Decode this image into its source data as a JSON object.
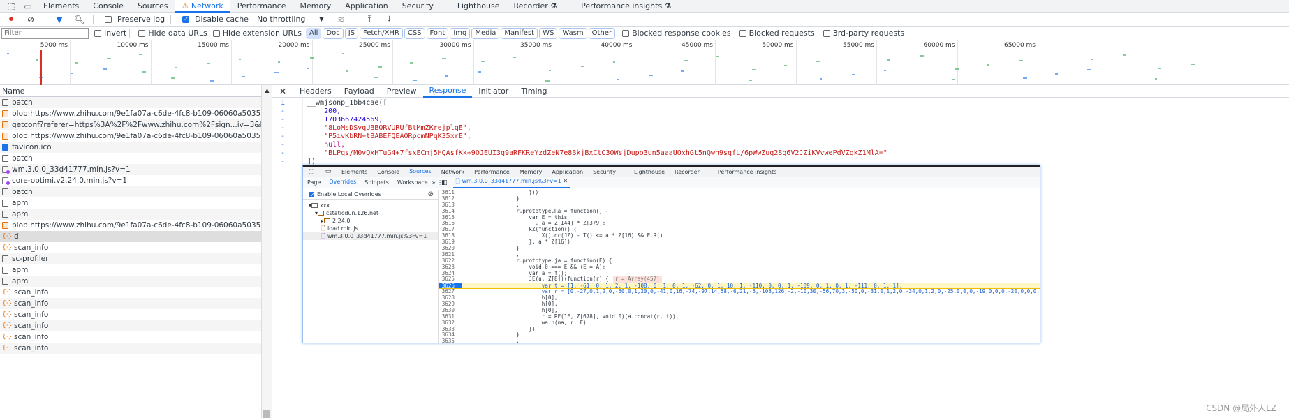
{
  "devtools_tabs": [
    "Elements",
    "Console",
    "Sources",
    "Network",
    "Performance",
    "Memory",
    "Application",
    "Security",
    "Lighthouse",
    "Recorder",
    "Performance insights"
  ],
  "active_tab": "Network",
  "toolbar": {
    "preserve_log": "Preserve log",
    "disable_cache": "Disable cache",
    "throttling": "No throttling"
  },
  "filter": {
    "placeholder": "Filter",
    "invert": "Invert",
    "hide_data": "Hide data URLs",
    "hide_ext": "Hide extension URLs",
    "types": [
      "All",
      "Doc",
      "JS",
      "Fetch/XHR",
      "CSS",
      "Font",
      "Img",
      "Media",
      "Manifest",
      "WS",
      "Wasm",
      "Other"
    ],
    "blocked_cookies": "Blocked response cookies",
    "blocked_requests": "Blocked requests",
    "third_party": "3rd-party requests"
  },
  "overview_ticks": [
    "5000 ms",
    "10000 ms",
    "15000 ms",
    "20000 ms",
    "25000 ms",
    "30000 ms",
    "35000 ms",
    "40000 ms",
    "45000 ms",
    "50000 ms",
    "55000 ms",
    "60000 ms",
    "65000 ms"
  ],
  "requests": {
    "header": "Name",
    "rows": [
      {
        "name": "batch",
        "type": "doc"
      },
      {
        "name": "blob:https://www.zhihu.com/9e1fa07a-c6de-4fc8-b109-06060a5035a0",
        "type": "xhr"
      },
      {
        "name": "getconf?referer=https%3A%2F%2Fwww.zhihu.com%2Fsign...iv=3&loadVersion=2.4.0&...",
        "type": "xhr"
      },
      {
        "name": "blob:https://www.zhihu.com/9e1fa07a-c6de-4fc8-b109-06060a5035a0",
        "type": "xhr"
      },
      {
        "name": "favicon.ico",
        "type": "fav"
      },
      {
        "name": "batch",
        "type": "doc"
      },
      {
        "name": "wm.3.0.0_33d41777.min.js?v=1",
        "type": "js"
      },
      {
        "name": "core-optimi.v2.24.0.min.js?v=1",
        "type": "js"
      },
      {
        "name": "batch",
        "type": "doc"
      },
      {
        "name": "apm",
        "type": "doc"
      },
      {
        "name": "apm",
        "type": "doc"
      },
      {
        "name": "blob:https://www.zhihu.com/9e1fa07a-c6de-4fc8-b109-06060a5035a0",
        "type": "xhr"
      },
      {
        "name": "d",
        "type": "json",
        "selected": true
      },
      {
        "name": "scan_info",
        "type": "json"
      },
      {
        "name": "sc-profiler",
        "type": "doc"
      },
      {
        "name": "apm",
        "type": "doc"
      },
      {
        "name": "apm",
        "type": "doc"
      },
      {
        "name": "scan_info",
        "type": "json"
      },
      {
        "name": "scan_info",
        "type": "json"
      },
      {
        "name": "scan_info",
        "type": "json"
      },
      {
        "name": "scan_info",
        "type": "json"
      },
      {
        "name": "scan_info",
        "type": "json"
      },
      {
        "name": "scan_info",
        "type": "json"
      }
    ]
  },
  "detail_tabs": [
    "Headers",
    "Payload",
    "Preview",
    "Response",
    "Initiator",
    "Timing"
  ],
  "detail_active": "Response",
  "response_lines": [
    {
      "ln": "1",
      "text": "__wmjsonp_1bb4cae([",
      "cls": ""
    },
    {
      "ln": "-",
      "text": "    200,",
      "cls": "num"
    },
    {
      "ln": "-",
      "text": "    1703667424569,",
      "cls": "num"
    },
    {
      "ln": "-",
      "text": "    \"8LoMsDSvqUBBQRVURUfBtMmZKrejplqE\",",
      "cls": "str"
    },
    {
      "ln": "-",
      "text": "    \"P5ivKbRN+tBABEFQEAORpcmNPqK35xrE\",",
      "cls": "str"
    },
    {
      "ln": "-",
      "text": "    null,",
      "cls": "kw"
    },
    {
      "ln": "-",
      "text": "    \"BLPqs/M0vQxHTuG4+7fsxECmj5HQAsfKk+9OJEUI3q9aRFKReYzdZeN7e8BkjBxCtC30WsjDupo3un5aaaUOxhGt5nQwh9sqfL/6pWwZuq28g6V2JZiKVvwePdVZqkZ1MlA=\"",
      "cls": "str"
    },
    {
      "ln": "-",
      "text": "])",
      "cls": ""
    }
  ],
  "embedded": {
    "tabs": [
      "Elements",
      "Console",
      "Sources",
      "Network",
      "Performance",
      "Memory",
      "Application",
      "Security",
      "Lighthouse",
      "Recorder",
      "Performance insights"
    ],
    "active_tab": "Sources",
    "subtabs": [
      "Page",
      "Overrides",
      "Snippets",
      "Workspace"
    ],
    "active_subtab": "Overrides",
    "enable_overrides": "Enable Local Overrides",
    "tree": [
      {
        "label": "xxx",
        "depth": 0
      },
      {
        "label": "cstaticdun.126.net",
        "depth": 1
      },
      {
        "label": "2.24.0",
        "depth": 2
      },
      {
        "label": "load.min.js",
        "depth": 2
      },
      {
        "label": "wm.3.0.0_33d41777.min.js%3Fv=1",
        "depth": 2
      }
    ],
    "file_tab": "wm.3.0.0_33d41777.min.js%3Fv=1",
    "highlight_line": "3626",
    "tooltip": "r = Array(457)",
    "code": [
      [
        "3611",
        "                    }))"
      ],
      [
        "3612",
        "                }"
      ],
      [
        "3613",
        "                ,"
      ],
      [
        "3614",
        "                r.prototype.Ra = function() {"
      ],
      [
        "3615",
        "                    var E = this"
      ],
      [
        "3616",
        "                      , a = Z[144] * Z[379];"
      ],
      [
        "3617",
        "                    kZ(function() {"
      ],
      [
        "3618",
        "                        X().oc(JZ) - T() <= a * Z[16] && E.R()"
      ],
      [
        "3619",
        "                    }, a * Z[16])"
      ],
      [
        "3620",
        "                }"
      ],
      [
        "3621",
        "                ,"
      ],
      [
        "3622",
        "                r.prototype.ja = function(E) {"
      ],
      [
        "3623",
        "                    void 0 === E && (E = A);"
      ],
      [
        "3624",
        "                    var a = f();"
      ],
      [
        "3625",
        "                    JE(u, Z[8])(function(r) {"
      ],
      [
        "3626",
        "                        var t = [1, -61, 0, 1, 2, 1, -108, 0, 1, 0, 1, -62, 0, 1, 10, 1, -110, 0, 0, 1, -109, 0, 1, 0, 1, -111, 0, 1, 1];"
      ],
      [
        "3627",
        "                        var r = [0,-27,0,1,2,0,-50,0,1,20,0,-41,0,16,-74,-97,14,58,-6,21,-5,-108,126,-2,-10,30,-56,70,3,-50,0,-31,0,1,2,0,-34,0,1,2,0,-25,0,0,0,-19,0,0,0,-20,0,0,0,-49,0,1,1,0,-38,0,1,2,"
      ],
      [
        "3628",
        "                        h[0],"
      ],
      [
        "3629",
        "                        h[0],"
      ],
      [
        "3630",
        "                        h[0],"
      ],
      [
        "3631",
        "                        r = RE(1E, Z[678], void 0)(a.concat(r, t)),"
      ],
      [
        "3632",
        "                        wa.h(ma, r, E)"
      ],
      [
        "3633",
        "                    })"
      ],
      [
        "3634",
        "                }"
      ],
      [
        "3635",
        "                ,"
      ]
    ]
  },
  "watermark": "CSDN @局外人LZ"
}
